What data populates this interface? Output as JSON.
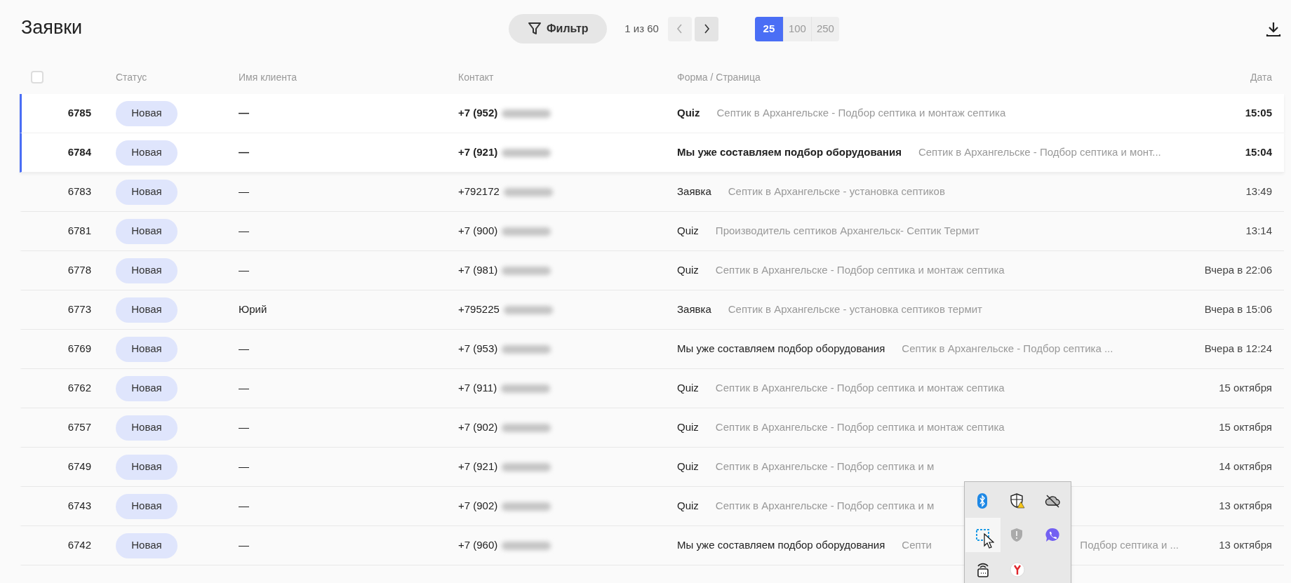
{
  "title": "Заявки",
  "filter_button": {
    "label": "Фильтр"
  },
  "pagination": {
    "range": "1 из 60",
    "prev": {
      "disabled": true
    },
    "next": {
      "disabled": false
    }
  },
  "page_sizes": [
    {
      "label": "25",
      "selected": true
    },
    {
      "label": "100",
      "selected": false
    },
    {
      "label": "250",
      "selected": false
    }
  ],
  "table": {
    "select_all": {
      "checked": false
    },
    "columns": [
      "Статус",
      "Имя клиента",
      "Контакт",
      "Форма / Страница",
      "Дата"
    ],
    "rows": [
      {
        "id": "6785",
        "status": "Новая",
        "name": "—",
        "contact": "+7 (952)",
        "form": "Quiz",
        "page": "Септик в Архангельске - Подбор септика и монтаж септика",
        "date": "15:05",
        "unread": true
      },
      {
        "id": "6784",
        "status": "Новая",
        "name": "—",
        "contact": "+7 (921)",
        "form": "Мы уже составляем подбор оборудования",
        "page": "Септик в Архангельске - Подбор септика и монт...",
        "date": "15:04",
        "unread": true
      },
      {
        "id": "6783",
        "status": "Новая",
        "name": "—",
        "contact": "+792172",
        "form": "Заявка",
        "page": "Септик в Архангельске - установка септиков",
        "date": "13:49",
        "unread": false
      },
      {
        "id": "6781",
        "status": "Новая",
        "name": "—",
        "contact": "+7 (900)",
        "form": "Quiz",
        "page": "Производитель септиков Архангельск- Септик Термит",
        "date": "13:14",
        "unread": false
      },
      {
        "id": "6778",
        "status": "Новая",
        "name": "—",
        "contact": "+7 (981)",
        "form": "Quiz",
        "page": "Септик в Архангельске - Подбор септика и монтаж септика",
        "date": "Вчера в 22:06",
        "unread": false
      },
      {
        "id": "6773",
        "status": "Новая",
        "name": "Юрий",
        "contact": "+795225",
        "form": "Заявка",
        "page": "Септик в Архангельске - установка септиков термит",
        "date": "Вчера в 15:06",
        "unread": false
      },
      {
        "id": "6769",
        "status": "Новая",
        "name": "—",
        "contact": "+7 (953)",
        "form": "Мы уже составляем подбор оборудования",
        "page": "Септик в Архангельске - Подбор септика ...",
        "date": "Вчера в 12:24",
        "unread": false
      },
      {
        "id": "6762",
        "status": "Новая",
        "name": "—",
        "contact": "+7 (911)",
        "form": "Quiz",
        "page": "Септик в Архангельске - Подбор септика и монтаж септика",
        "date": "15 октября",
        "unread": false
      },
      {
        "id": "6757",
        "status": "Новая",
        "name": "—",
        "contact": "+7 (902)",
        "form": "Quiz",
        "page": "Септик в Архангельске - Подбор септика и монтаж септика",
        "date": "15 октября",
        "unread": false
      },
      {
        "id": "6749",
        "status": "Новая",
        "name": "—",
        "contact": "+7 (921)",
        "form": "Quiz",
        "page": "Септик в Архангельске - Подбор септика и м",
        "date": "14 октября",
        "unread": false
      },
      {
        "id": "6743",
        "status": "Новая",
        "name": "—",
        "contact": "+7 (902)",
        "form": "Quiz",
        "page": "Септик в Архангельске - Подбор септика и м",
        "date": "13 октября",
        "unread": false
      },
      {
        "id": "6742",
        "status": "Новая",
        "name": "—",
        "contact": "+7 (960)",
        "form": "Мы уже составляем подбор оборудования",
        "page": "Септи",
        "page_tail": "Подбор септика и ...",
        "date": "13 октября",
        "unread": false
      }
    ]
  },
  "tray_popup": {
    "items": [
      {
        "kind": "bluetooth",
        "hovered": false
      },
      {
        "kind": "shield-warning",
        "hovered": false
      },
      {
        "kind": "cloud-off",
        "hovered": false
      },
      {
        "kind": "snip",
        "hovered": true
      },
      {
        "kind": "shield-gray",
        "hovered": false
      },
      {
        "kind": "chat-phone",
        "hovered": false
      },
      {
        "kind": "lock-wifi",
        "hovered": false
      },
      {
        "kind": "browser",
        "hovered": false
      }
    ]
  }
}
